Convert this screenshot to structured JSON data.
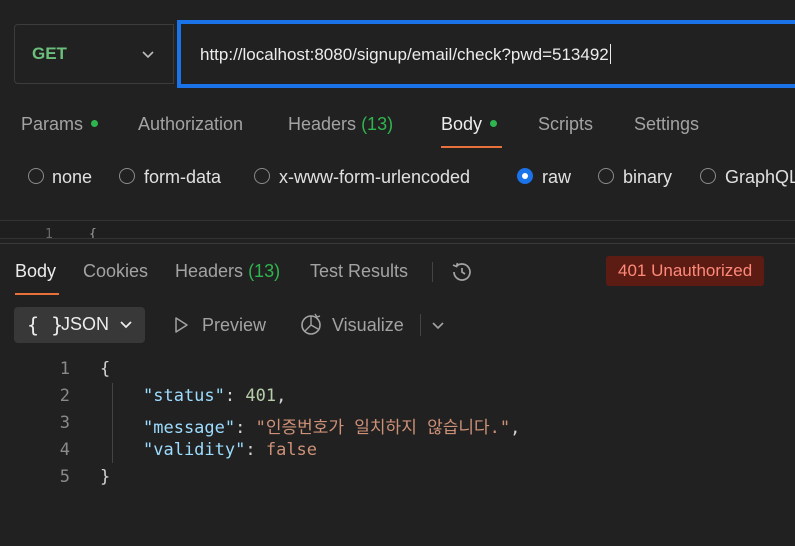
{
  "request": {
    "method": "GET",
    "url": "http://localhost:8080/signup/email/check?pwd=513492"
  },
  "request_tabs": {
    "params": "Params",
    "authorization": "Authorization",
    "headers": "Headers",
    "headers_count": "(13)",
    "body": "Body",
    "scripts": "Scripts",
    "settings": "Settings"
  },
  "body_types": {
    "none": "none",
    "form_data": "form-data",
    "urlencoded": "x-www-form-urlencoded",
    "raw": "raw",
    "binary": "binary",
    "graphql": "GraphQL",
    "selected": "raw"
  },
  "editor_preview": {
    "line": "1",
    "text": "{"
  },
  "response_tabs": {
    "body": "Body",
    "cookies": "Cookies",
    "headers": "Headers",
    "headers_count": "(13)",
    "test_results": "Test Results"
  },
  "status": {
    "text": "401 Unauthorized",
    "color": "#ff8a7a",
    "bg": "#5c1b13"
  },
  "response_toolbar": {
    "format_icon": "{ }",
    "format": "JSON",
    "preview": "Preview",
    "visualize": "Visualize"
  },
  "response_body": {
    "line_numbers": [
      "1",
      "2",
      "3",
      "4",
      "5"
    ],
    "open_brace": "{",
    "close_brace": "}",
    "fields": [
      {
        "key": "\"status\"",
        "value": "401",
        "suffix": ","
      },
      {
        "key": "\"message\"",
        "value": "\"인증번호가 일치하지 않습니다.\"",
        "suffix": ","
      },
      {
        "key": "\"validity\"",
        "value": "false",
        "suffix": ""
      }
    ]
  },
  "colors": {
    "accent_orange": "#e8703a",
    "focus_blue": "#1a73e8",
    "success_green": "#2fb54f",
    "method_green": "#6bbf7a"
  }
}
